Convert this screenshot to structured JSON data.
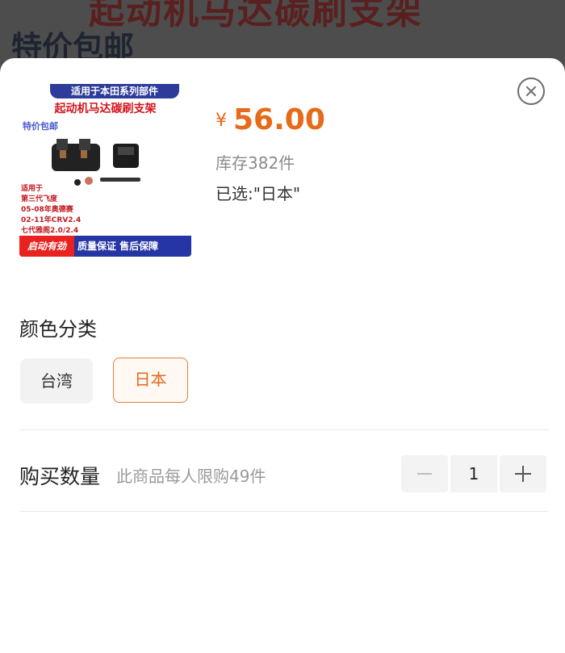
{
  "background": {
    "title_red": "起动机马达碳刷支架",
    "title_dark": "特价包邮"
  },
  "product_image": {
    "top_banner": "适用于本田系列部件",
    "headline": "起动机马达碳刷支架",
    "badge": "特价包邮",
    "fitment": [
      "适用于",
      "第三代飞度",
      "05-08年奥德赛",
      "02-11年CRV2.4",
      "七代雅阁2.0/2.4"
    ],
    "strip_red": "启动有劲",
    "strip_text": "质量保证  售后保障"
  },
  "product": {
    "currency": "¥",
    "price": "56.00",
    "stock": "库存382件",
    "selected": "已选:\"日本\""
  },
  "color_section": {
    "label": "颜色分类",
    "options": [
      {
        "label": "台湾",
        "selected": false
      },
      {
        "label": "日本",
        "selected": true
      }
    ]
  },
  "quantity": {
    "label": "购买数量",
    "limit_text": "此商品每人限购49件",
    "value": "1"
  },
  "colors": {
    "accent": "#e66a17",
    "selected_border": "#e0803a"
  },
  "icons": {
    "close": "close-circle-icon",
    "minus": "minus-icon",
    "plus": "plus-icon"
  }
}
